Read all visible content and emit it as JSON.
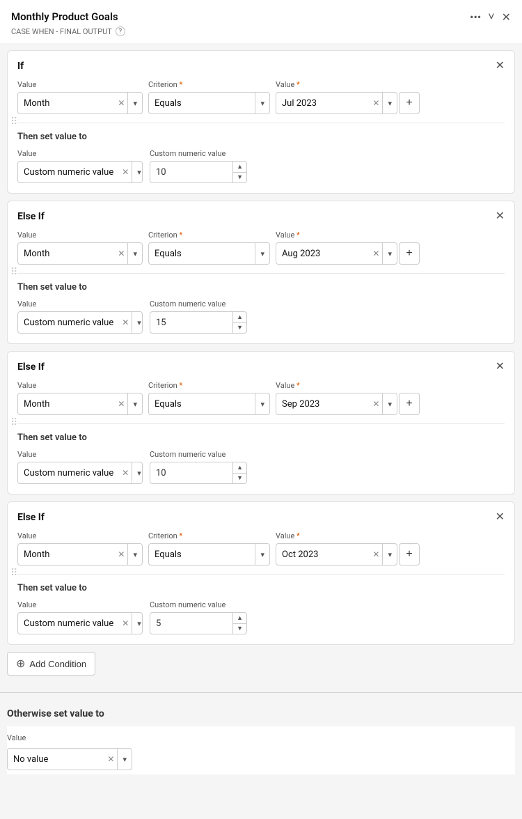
{
  "header": {
    "title": "Monthly Product Goals",
    "subtitle": "CASE WHEN - FINAL OUTPUT",
    "more_icon": "•••",
    "chevron_icon": "˅",
    "close_icon": "✕"
  },
  "blocks": [
    {
      "id": "if-block",
      "type": "If",
      "value_label": "Value",
      "criterion_label": "Criterion",
      "value_req_label": "Value",
      "value_field": "Month",
      "criterion_field": "Equals",
      "value_date": "Jul 2023",
      "then_label": "Then set value to",
      "then_value_label": "Value",
      "then_custom_label": "Custom numeric value",
      "then_value_field": "Custom numeric value",
      "then_numeric": "10"
    },
    {
      "id": "else-if-1",
      "type": "Else If",
      "value_label": "Value",
      "criterion_label": "Criterion",
      "value_req_label": "Value",
      "value_field": "Month",
      "criterion_field": "Equals",
      "value_date": "Aug 2023",
      "then_label": "Then set value to",
      "then_value_label": "Value",
      "then_custom_label": "Custom numeric value",
      "then_value_field": "Custom numeric value",
      "then_numeric": "15"
    },
    {
      "id": "else-if-2",
      "type": "Else If",
      "value_label": "Value",
      "criterion_label": "Criterion",
      "value_req_label": "Value",
      "value_field": "Month",
      "criterion_field": "Equals",
      "value_date": "Sep 2023",
      "then_label": "Then set value to",
      "then_value_label": "Value",
      "then_custom_label": "Custom numeric value",
      "then_value_field": "Custom numeric value",
      "then_numeric": "10"
    },
    {
      "id": "else-if-3",
      "type": "Else If",
      "value_label": "Value",
      "criterion_label": "Criterion",
      "value_req_label": "Value",
      "value_field": "Month",
      "criterion_field": "Equals",
      "value_date": "Oct 2023",
      "then_label": "Then set value to",
      "then_value_label": "Value",
      "then_custom_label": "Custom numeric value",
      "then_value_field": "Custom numeric value",
      "then_numeric": "5"
    }
  ],
  "add_condition_label": "Add Condition",
  "otherwise": {
    "label": "Otherwise set value to",
    "value_label": "Value",
    "value_field": "No value"
  }
}
